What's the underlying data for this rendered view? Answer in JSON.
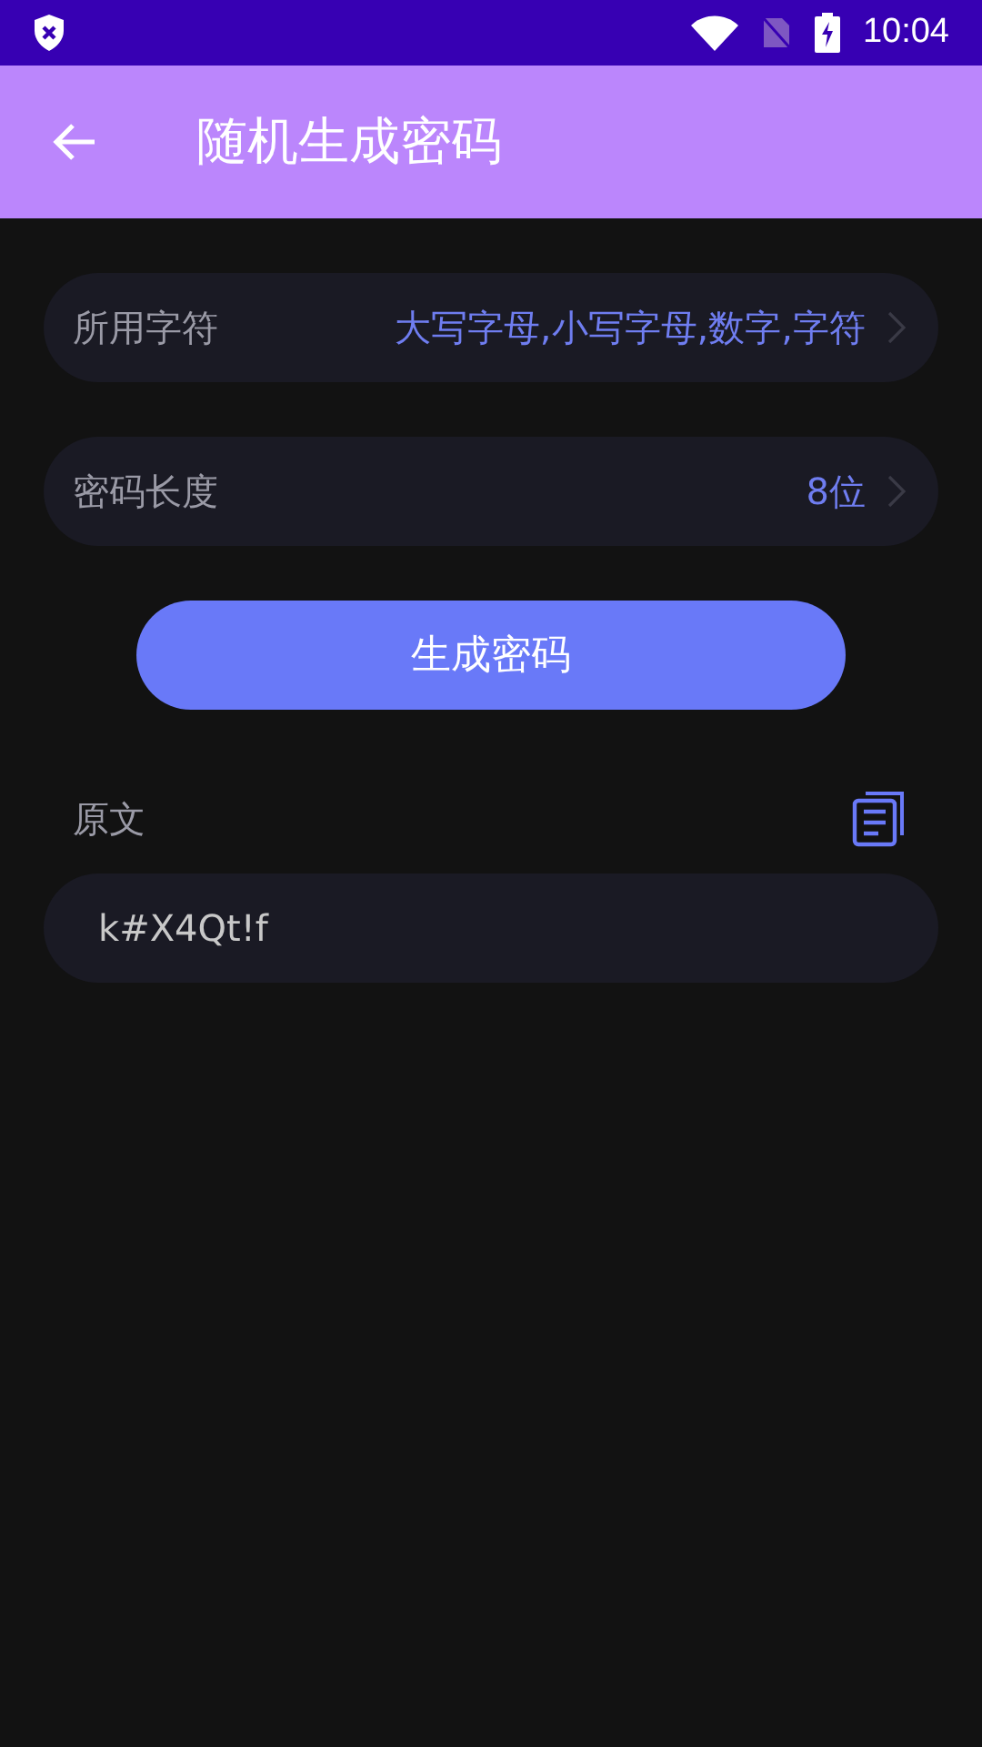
{
  "status_bar": {
    "time": "10:04"
  },
  "toolbar": {
    "title": "随机生成密码"
  },
  "settings": [
    {
      "label": "所用字符",
      "value": "大写字母,小写字母,数字,字符"
    },
    {
      "label": "密码长度",
      "value": "8位"
    }
  ],
  "generate_button": "生成密码",
  "result": {
    "label": "原文",
    "value": "k#X4Qt!f"
  }
}
